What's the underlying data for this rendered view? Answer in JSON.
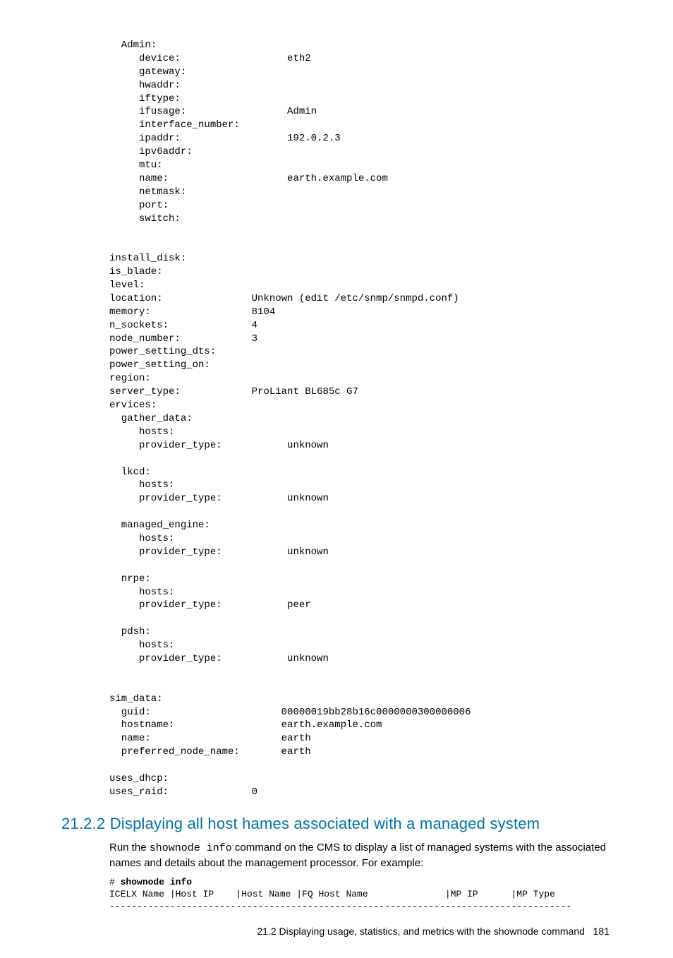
{
  "code_block": "  Admin:\n     device:                  eth2\n     gateway:\n     hwaddr:\n     iftype:\n     ifusage:                 Admin\n     interface_number:\n     ipaddr:                  192.0.2.3\n     ipv6addr:\n     mtu:\n     name:                    earth.example.com\n     netmask:\n     port:\n     switch:\n\n\ninstall_disk:\nis_blade:\nlevel:\nlocation:               Unknown (edit /etc/snmp/snmpd.conf)\nmemory:                 8104\nn_sockets:              4\nnode_number:            3\npower_setting_dts:\npower_setting_on:\nregion:\nserver_type:            ProLiant BL685c G7\nervices:\n  gather_data:\n     hosts:\n     provider_type:           unknown\n\n  lkcd:\n     hosts:\n     provider_type:           unknown\n\n  managed_engine:\n     hosts:\n     provider_type:           unknown\n\n  nrpe:\n     hosts:\n     provider_type:           peer\n\n  pdsh:\n     hosts:\n     provider_type:           unknown\n\n\nsim_data:\n  guid:                      00000019bb28b16c0000000300000006\n  hostname:                  earth.example.com\n  name:                      earth\n  preferred_node_name:       earth\n\nuses_dhcp:\nuses_raid:              0",
  "section": {
    "number": "21.2.2",
    "title": "Displaying all host hames associated with a managed system"
  },
  "body": {
    "prefix": "Run the ",
    "command": "shownode info",
    "suffix": " command on the CMS to display a list of managed systems with the associated names and details about the management processor. For example:"
  },
  "example": {
    "prompt": "# ",
    "command": "shownode info",
    "header": "ICELX Name |Host IP    |Host Name |FQ Host Name              |MP IP      |MP Type",
    "rule": "------------------------------------------------------------------------------------"
  },
  "footer": {
    "text": "21.2 Displaying usage, statistics, and metrics with the shownode command",
    "page": "181"
  }
}
